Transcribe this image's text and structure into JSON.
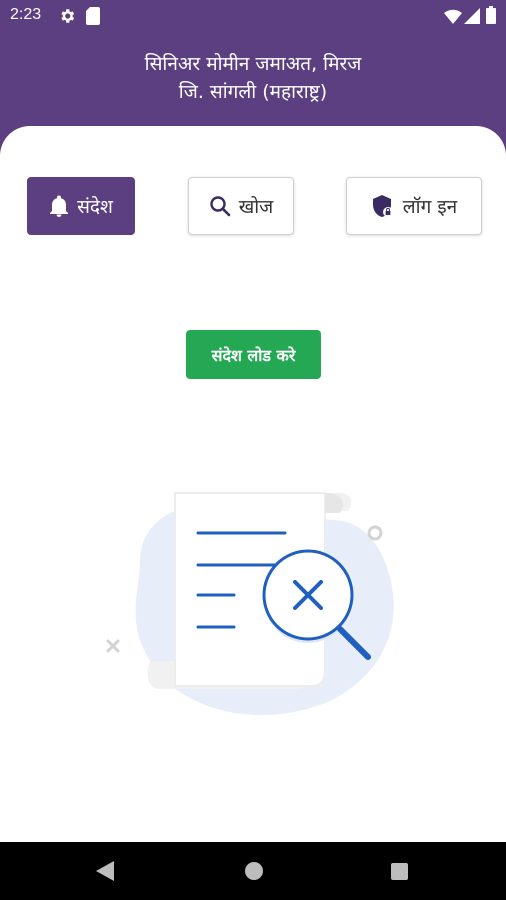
{
  "status_bar": {
    "time": "2:23"
  },
  "header": {
    "title_line1": "सिनिअर मोमीन जमाअत, मिरज",
    "title_line2": "जि. सांगली (महाराष्ट्र)"
  },
  "tabs": [
    {
      "label": "संदेश",
      "icon": "bell-icon",
      "active": true
    },
    {
      "label": "खोज",
      "icon": "search-icon",
      "active": false
    },
    {
      "label": "लॉग इन",
      "icon": "shield-lock-icon",
      "active": false
    }
  ],
  "load_button": {
    "label": "संदेश लोड करे"
  },
  "empty_state": {
    "illustration": "document-search-not-found"
  },
  "colors": {
    "primary": "#5b3f80",
    "load_button": "#24a853",
    "illustration_blue": "#1f5fbf"
  },
  "nav_bar": {
    "icons": [
      "back-icon",
      "home-icon",
      "recents-icon"
    ]
  }
}
